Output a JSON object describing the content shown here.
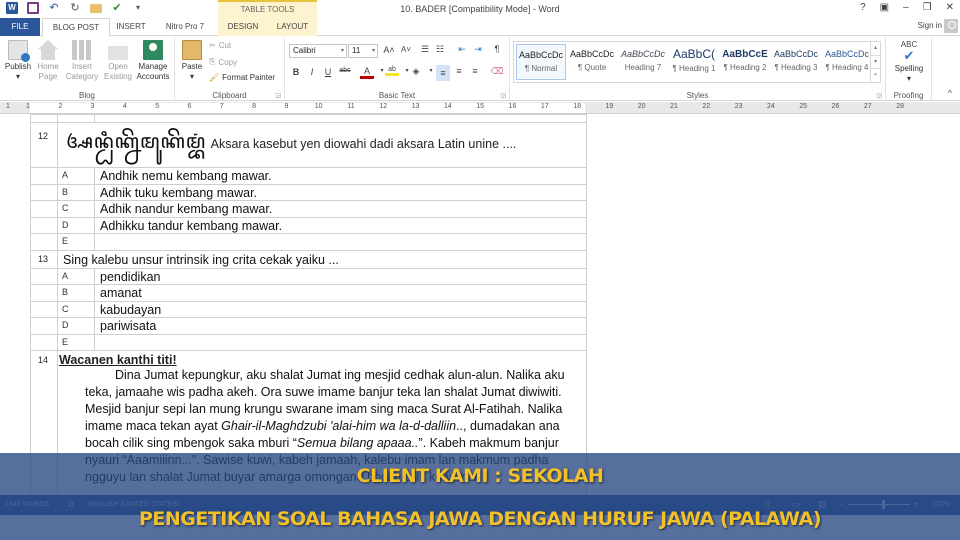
{
  "window": {
    "title": "10. BADER [Compatibility Mode] - Word",
    "contextual_tab_group": "TABLE TOOLS",
    "controls": [
      "?",
      "▣",
      "–",
      "❐",
      "✕"
    ],
    "sign_in": "Sign in"
  },
  "quick_access": [
    "word-icon",
    "save-icon",
    "undo-icon",
    "redo-icon",
    "open-icon",
    "publish-icon",
    "customize-icon"
  ],
  "tabs": [
    {
      "label": "FILE"
    },
    {
      "label": "BLOG POST",
      "active": true
    },
    {
      "label": "INSERT"
    },
    {
      "label": "Nitro Pro 7"
    },
    {
      "label": "DESIGN",
      "contextual": true
    },
    {
      "label": "LAYOUT",
      "contextual": true
    }
  ],
  "ribbon": {
    "blog": {
      "label": "Blog",
      "buttons": [
        {
          "label1": "Publish",
          "label2": "▾"
        },
        {
          "label1": "Home",
          "label2": "Page"
        },
        {
          "label1": "Insert",
          "label2": "Category"
        },
        {
          "label1": "Open",
          "label2": "Existing"
        },
        {
          "label1": "Manage",
          "label2": "Accounts"
        }
      ]
    },
    "clipboard": {
      "label": "Clipboard",
      "paste": "Paste",
      "paste_arrow": "▾",
      "cut": "Cut",
      "copy": "Copy",
      "format_painter": "Format Painter"
    },
    "basic_text": {
      "label": "Basic Text",
      "font_name": "Calibri",
      "font_size": "11",
      "bold": "B",
      "italic": "I",
      "underline": "U",
      "strike": "abc",
      "grow": "A˄",
      "shrink": "A˅",
      "pilcrow": "¶"
    },
    "styles": {
      "label": "Styles",
      "items": [
        {
          "preview": "AaBbCcDc",
          "name": "¶ Normal",
          "selected": true
        },
        {
          "preview": "AaBbCcDc",
          "name": "¶ Quote"
        },
        {
          "preview": "AaBbCcDc",
          "name": "Heading 7"
        },
        {
          "preview": "AaBbC(",
          "name": "¶ Heading 1"
        },
        {
          "preview": "AaBbCcE",
          "name": "¶ Heading 2"
        },
        {
          "preview": "AaBbCcDc",
          "name": "¶ Heading 3"
        },
        {
          "preview": "AaBbCcDc",
          "name": "¶ Heading 4"
        }
      ]
    },
    "proofing": {
      "label": "Proofing",
      "spelling_top": "ABC",
      "spelling": "Spelling",
      "arrow": "▾"
    },
    "collapse": "^"
  },
  "ruler": {
    "numbers": [
      "1",
      "1",
      "2",
      "3",
      "4",
      "5",
      "6",
      "7",
      "8",
      "9",
      "10",
      "11",
      "12",
      "13",
      "14",
      "15",
      "16",
      "17",
      "18",
      "19",
      "20",
      "21",
      "22",
      "23",
      "24",
      "25",
      "26",
      "27",
      "28"
    ]
  },
  "document": {
    "q12": {
      "number": "12",
      "javanese": "ꦄꦤ꧀ꦝꦶꦏ꧀ꦤꦼꦩꦸꦏꦼꦩ꧀ꦧꦁ",
      "question": "Aksara kasebut yen diowahi dadi aksara Latin unine ....",
      "options": [
        {
          "key": "A",
          "text": "Andhik nemu kembang mawar."
        },
        {
          "key": "B",
          "text": "Adhik tuku kembang mawar."
        },
        {
          "key": "C",
          "text": "Adhik nandur kembang mawar."
        },
        {
          "key": "D",
          "text": "Adhikku tandur kembang mawar."
        },
        {
          "key": "E",
          "text": ""
        }
      ]
    },
    "q13": {
      "number": "13",
      "question": "Sing kalebu unsur intrinsik ing crita cekak yaiku ...",
      "options": [
        {
          "key": "A",
          "text": "pendidikan"
        },
        {
          "key": "B",
          "text": "amanat"
        },
        {
          "key": "C",
          "text": "kabudayan"
        },
        {
          "key": "D",
          "text": "pariwisata"
        },
        {
          "key": "E",
          "text": ""
        }
      ]
    },
    "q14": {
      "number": "14",
      "heading": "Wacanen kanthi titi!",
      "p1": "Dina Jumat kepungkur, aku shalat Jumat ing mesjid cedhak alun-alun. Nalika aku teka, jamaahe wis padha akeh. Ora suwe imame banjur teka lan shalat Jumat diwiwiti. Mesjid banjur sepi lan mung krungu swarane imam sing maca Surat Al-Fatihah. Nalika imame maca tekan ayat ",
      "p1_italic": "Ghair-il-Maghdzubi 'alai-him wa la-d-dalliin",
      "p2": ".., dumadakan ana bocah cilik sing mbengok saka mburi “",
      "p2_italic": "Semua bilang apaaa..",
      "p3": "”. Kabeh makmum banjur nyauri “Aaamiiinn...”. Sawise kuwi, kabeh jamaah, kalebu imam lan makmum padha ngguyu lan shalat Jumat buyar amarga omongane bocah cilik kuwi mau."
    }
  },
  "statusbar": {
    "words": "2342 WORDS",
    "language": "ENGLISH (UNITED STATES)",
    "zoom_minus": "-",
    "zoom_plus": "+",
    "zoom": "120%",
    "zoom_value_percent": 120
  },
  "banner": {
    "line1": "CLIENT KAMI : SEKOLAH",
    "line2": "PENGETIKAN SOAL BAHASA JAWA DENGAN HURUF JAWA (PALAWA)",
    "text_color": "#f2c028",
    "bg_color": "#284682"
  },
  "colors": {
    "word_blue": "#2b579a",
    "contextual_tab": "#fdf3cf",
    "contextual_accent": "#e8c23c"
  }
}
